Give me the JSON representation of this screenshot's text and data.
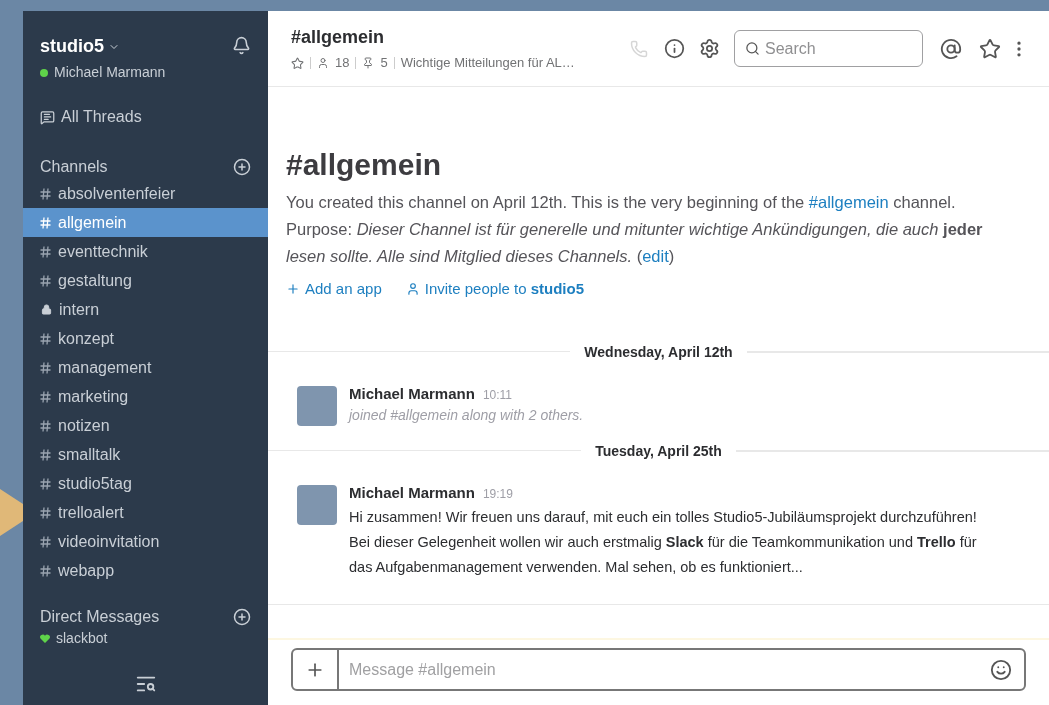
{
  "workspace": {
    "name": "studio5",
    "user": "Michael Marmann",
    "online": true
  },
  "sidebar": {
    "threads_label": "All Threads",
    "channels_heading": "Channels",
    "channels": [
      {
        "kind": "public",
        "name": "absolventenfeier",
        "selected": false,
        "pointed": false
      },
      {
        "kind": "public",
        "name": "allgemein",
        "selected": true,
        "pointed": false
      },
      {
        "kind": "public",
        "name": "eventtechnik",
        "selected": false,
        "pointed": false
      },
      {
        "kind": "public",
        "name": "gestaltung",
        "selected": false,
        "pointed": false
      },
      {
        "kind": "private",
        "name": "intern",
        "selected": false,
        "pointed": false
      },
      {
        "kind": "public",
        "name": "konzept",
        "selected": false,
        "pointed": false
      },
      {
        "kind": "public",
        "name": "management",
        "selected": false,
        "pointed": false
      },
      {
        "kind": "public",
        "name": "marketing",
        "selected": false,
        "pointed": false
      },
      {
        "kind": "public",
        "name": "notizen",
        "selected": false,
        "pointed": false
      },
      {
        "kind": "public",
        "name": "smalltalk",
        "selected": false,
        "pointed": false
      },
      {
        "kind": "public",
        "name": "studio5tag",
        "selected": false,
        "pointed": false
      },
      {
        "kind": "public",
        "name": "trelloalert",
        "selected": false,
        "pointed": true
      },
      {
        "kind": "public",
        "name": "videoinvitation",
        "selected": false,
        "pointed": false
      },
      {
        "kind": "public",
        "name": "webapp",
        "selected": false,
        "pointed": false
      }
    ],
    "dm_heading": "Direct Messages",
    "direct_messages": [
      {
        "name": "slackbot"
      }
    ]
  },
  "header": {
    "channel": "#allgemein",
    "members": "18",
    "pins": "5",
    "topic": "Wichtige Mitteilungen für AL…",
    "search_placeholder": "Search"
  },
  "intro": {
    "title": "#allgemein",
    "segments": [
      {
        "kind": "text",
        "text": "You created this channel on April 12th. This is the very beginning of the "
      },
      {
        "kind": "link",
        "text": "#allgemein"
      },
      {
        "kind": "text",
        "text": " channel. Purpose: *Dieser Channel ist für generelle und mitunter wichtige Ankündigungen, die auch* **jeder** *lesen sollte. Alle sind Mitglied dieses Channels.* ("
      },
      {
        "kind": "link",
        "text": "edit"
      },
      {
        "kind": "text",
        "text": ")"
      }
    ],
    "add_app": "Add an app",
    "invite": "Invite people to **studio5**"
  },
  "days": [
    {
      "date": "Wednesday, April 12th",
      "messages": [
        {
          "kind": "system",
          "author": "Michael Marmann",
          "time": "10:11",
          "text": "joined #allgemein along with 2 others."
        }
      ]
    },
    {
      "date": "Tuesday, April 25th",
      "messages": [
        {
          "kind": "normal",
          "author": "Michael Marmann",
          "time": "19:19",
          "text": "Hi zusammen! Wir freuen uns darauf, mit euch ein tolles Studio5-Jubiläumsprojekt durchzuführen! Bei dieser Gelegenheit wollen wir auch erstmalig **Slack** für die Teamkommunikation und **Trello** für das Aufgabenmanagement verwenden. Mal sehen, ob es funktioniert..."
        }
      ]
    }
  ],
  "composer": {
    "placeholder": "Message #allgemein"
  }
}
